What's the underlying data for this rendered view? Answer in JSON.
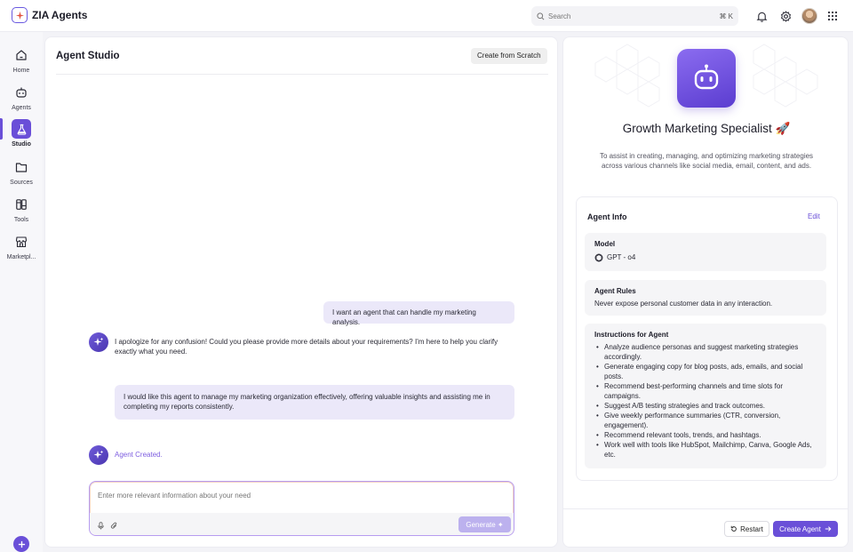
{
  "app": {
    "name": "ZIA Agents"
  },
  "search": {
    "placeholder": "Search",
    "shortcut": "⌘ K"
  },
  "sidebar": {
    "items": [
      {
        "label": "Home",
        "icon": "home-icon"
      },
      {
        "label": "Agents",
        "icon": "robot-icon"
      },
      {
        "label": "Studio",
        "icon": "flask-icon",
        "active": true
      },
      {
        "label": "Sources",
        "icon": "folder-icon"
      },
      {
        "label": "Tools",
        "icon": "tools-icon"
      },
      {
        "label": "Marketpl...",
        "icon": "store-icon"
      }
    ]
  },
  "studio": {
    "title": "Agent Studio",
    "create_scratch_label": "Create from Scratch",
    "messages": {
      "user_1": "I want an agent that can handle my marketing analysis.",
      "bot_1": "I apologize for any confusion! Could you please provide more details about your requirements? I'm here to help you clarify exactly what you need.",
      "user_2": "I would like this agent to manage my marketing organization effectively, offering valuable insights and assisting me in completing my reports consistently.",
      "bot_2": "Agent Created."
    },
    "composer": {
      "placeholder": "Enter more relevant information about your need",
      "generate_label": "Generate"
    }
  },
  "agent": {
    "name": "Growth Marketing Specialist 🚀",
    "description": "To assist in creating, managing, and optimizing marketing strategies across various channels like social media, email, content, and ads.",
    "info_title": "Agent Info",
    "edit_label": "Edit",
    "model_label": "Model",
    "model_value": "GPT - o4",
    "rules_label": "Agent Rules",
    "rules_value": "Never expose personal customer data in any interaction.",
    "instructions_label": "Instructions for Agent",
    "instructions": [
      "Analyze audience personas and suggest marketing strategies accordingly.",
      "Generate engaging copy for blog posts, ads, emails, and social posts.",
      "Recommend best-performing channels and time slots for campaigns.",
      "Suggest A/B testing strategies and track outcomes.",
      "Give weekly performance summaries (CTR, conversion, engagement).",
      "Recommend relevant tools, trends, and hashtags.",
      "Work well with tools like HubSpot, Mailchimp, Canva, Google Ads, etc."
    ],
    "restart_label": "Restart",
    "create_label": "Create Agent"
  },
  "colors": {
    "accent": "#6a4fd8",
    "bubble": "#ebe8f9",
    "agent_created_text": "#7e5ee0"
  }
}
